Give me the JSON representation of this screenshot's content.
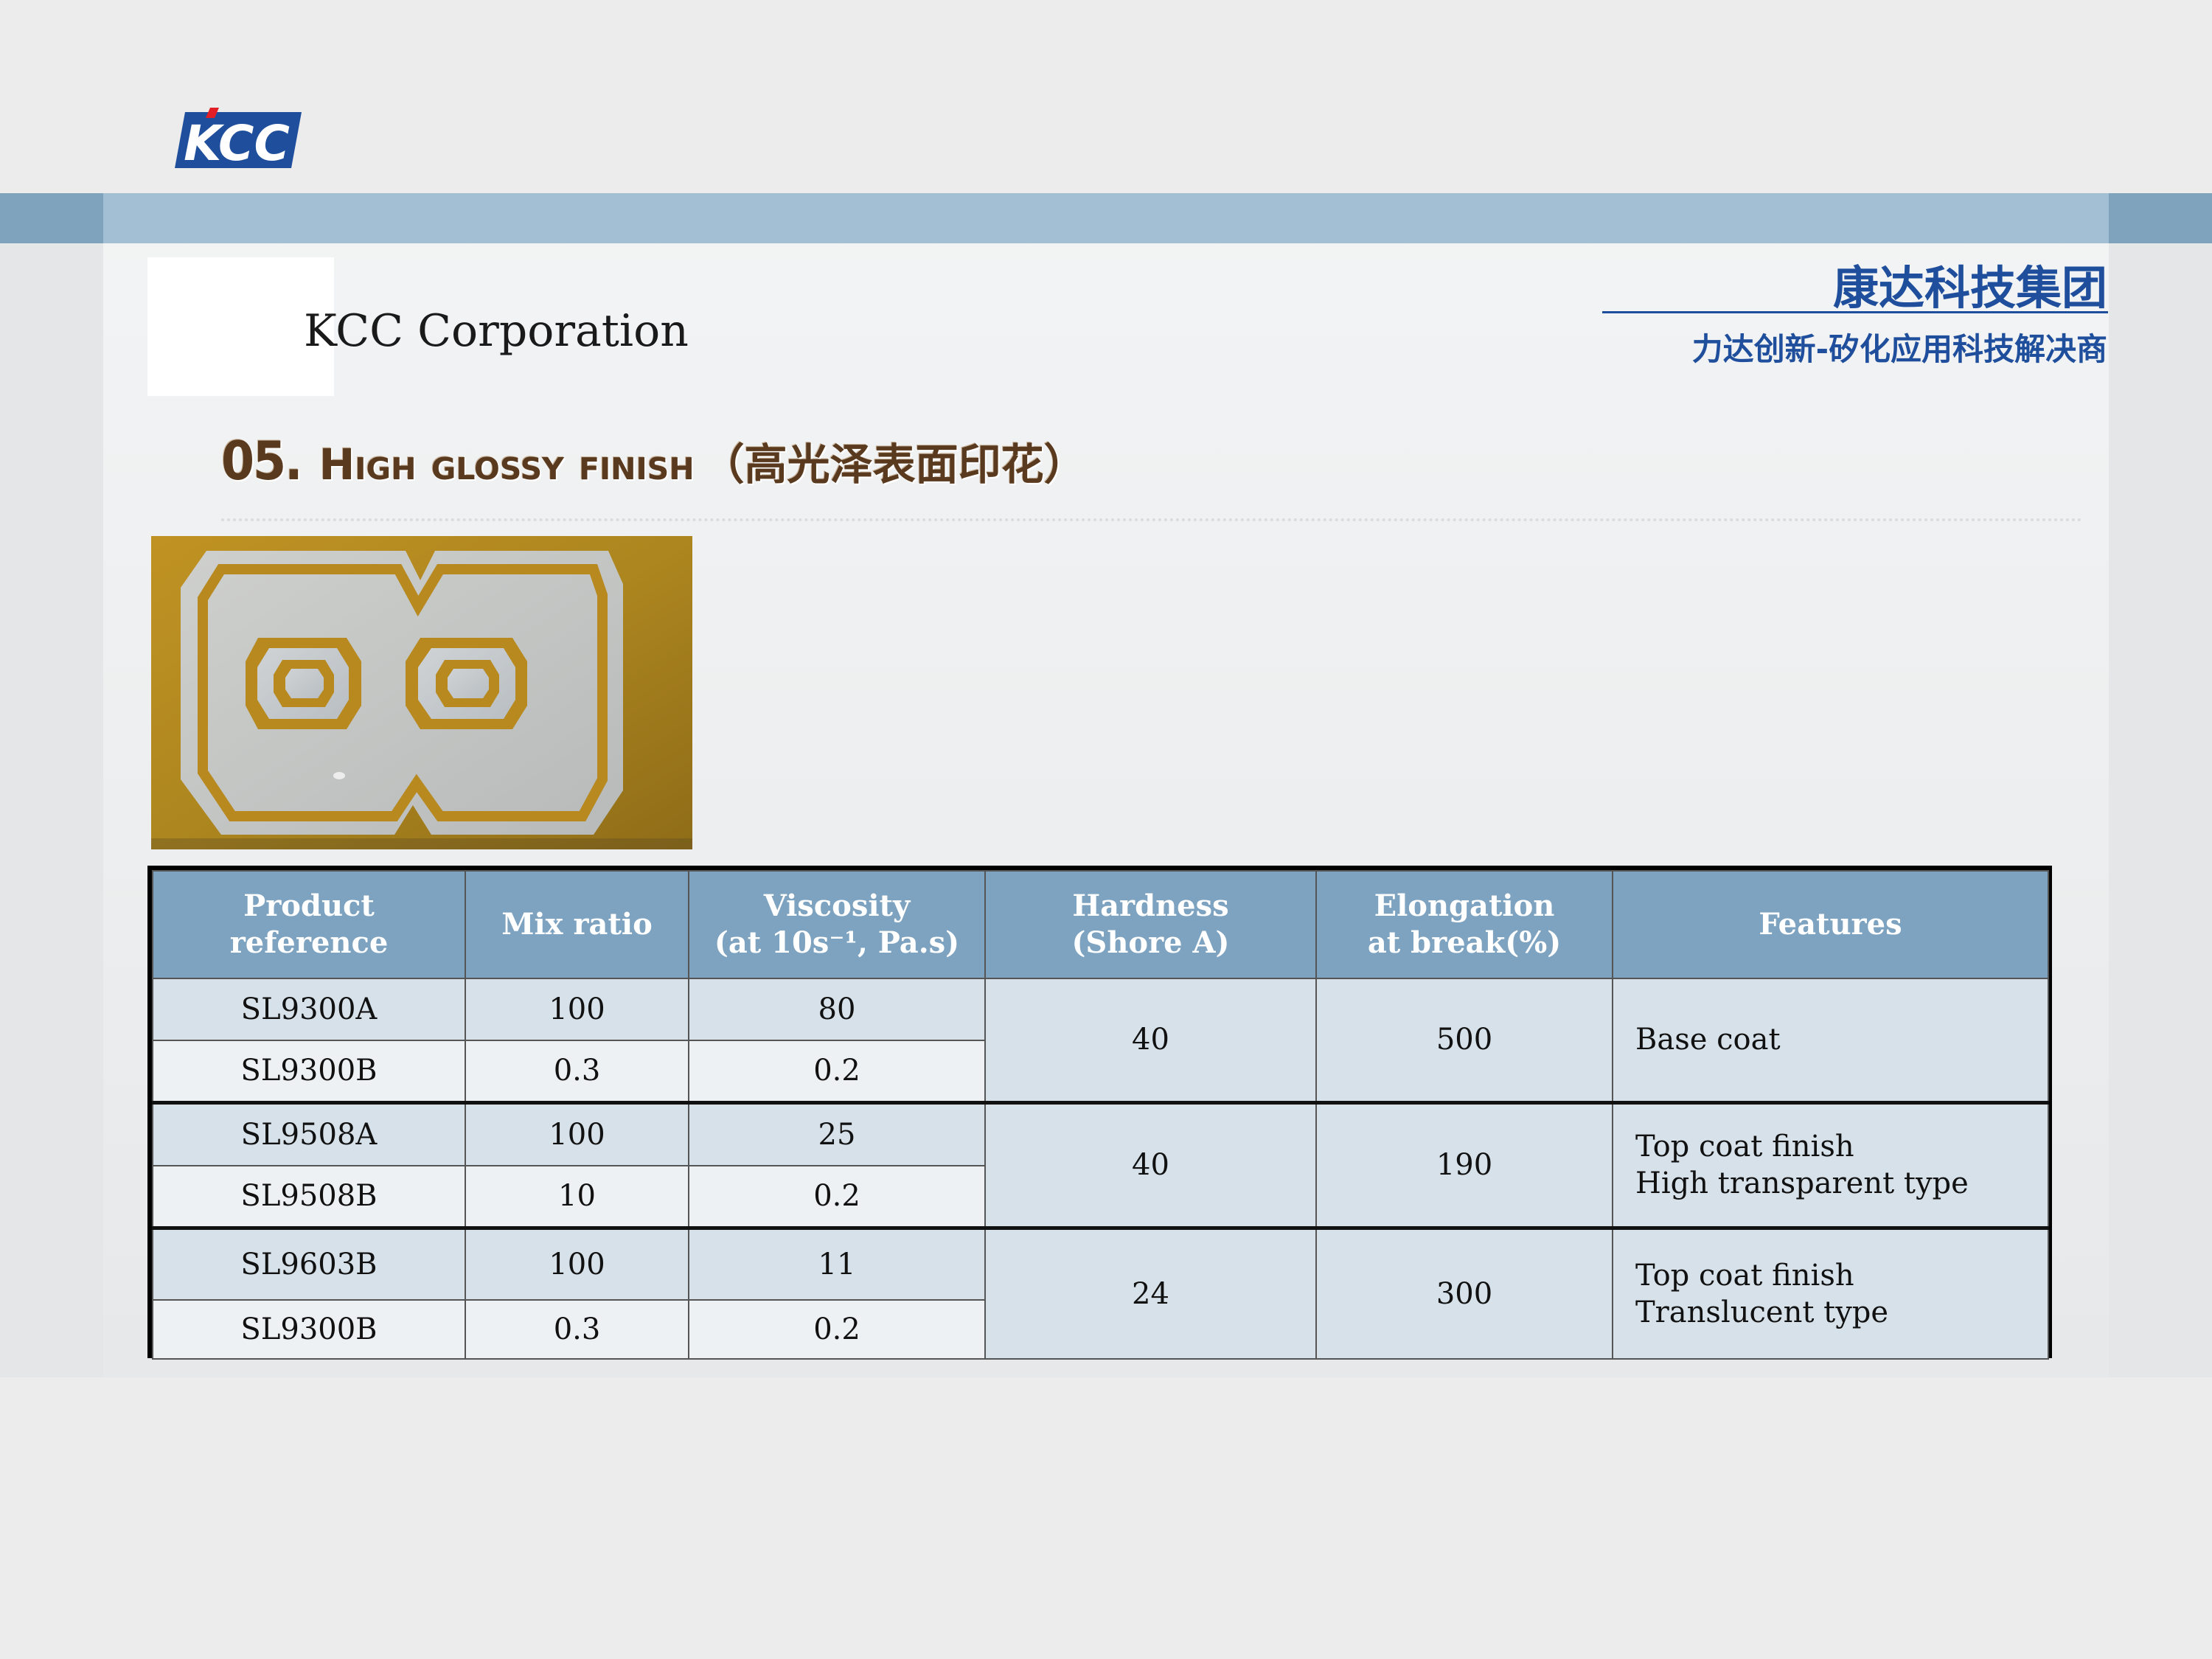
{
  "header": {
    "logo_text": "KCC Corporation",
    "logo_mark": "KCC",
    "brand_cn": "康达科技集团",
    "brand_sub": "力达创新-矽化应用科技解决商"
  },
  "section": {
    "number": "05.",
    "title_en": "High glossy finish",
    "title_cn": "（高光泽表面印花）"
  },
  "table": {
    "headers": [
      {
        "line1": "Product",
        "line2": "reference"
      },
      {
        "line1": "Mix ratio",
        "line2": ""
      },
      {
        "line1": "Viscosity",
        "line2": "(at 10s⁻¹, Pa.s)"
      },
      {
        "line1": "Hardness",
        "line2": "(Shore A)"
      },
      {
        "line1": "Elongation",
        "line2": "at break(%)"
      },
      {
        "line1": "Features",
        "line2": ""
      }
    ],
    "groups": [
      {
        "rows": [
          {
            "product": "SL9300A",
            "mix": "100",
            "viscosity": "80"
          },
          {
            "product": "SL9300B",
            "mix": "0.3",
            "viscosity": "0.2"
          }
        ],
        "hardness": "40",
        "elongation": "500",
        "features": [
          "Base coat"
        ]
      },
      {
        "rows": [
          {
            "product": "SL9508A",
            "mix": "100",
            "viscosity": "25"
          },
          {
            "product": "SL9508B",
            "mix": "10",
            "viscosity": "0.2"
          }
        ],
        "hardness": "40",
        "elongation": "190",
        "features": [
          "Top coat finish",
          "High transparent type"
        ]
      },
      {
        "rows": [
          {
            "product": "SL9603B",
            "mix": "100",
            "viscosity": "11"
          },
          {
            "product": "SL9300B",
            "mix": "0.3",
            "viscosity": "0.2"
          }
        ],
        "hardness": "24",
        "elongation": "300",
        "features": [
          "Top coat finish",
          "Translucent  type"
        ]
      }
    ]
  },
  "colors": {
    "brand_blue": "#1f4f9c",
    "header_cell": "#7ea3c0",
    "title_brown": "#5a3a1e",
    "photo_fabric": "#b58a1f"
  }
}
